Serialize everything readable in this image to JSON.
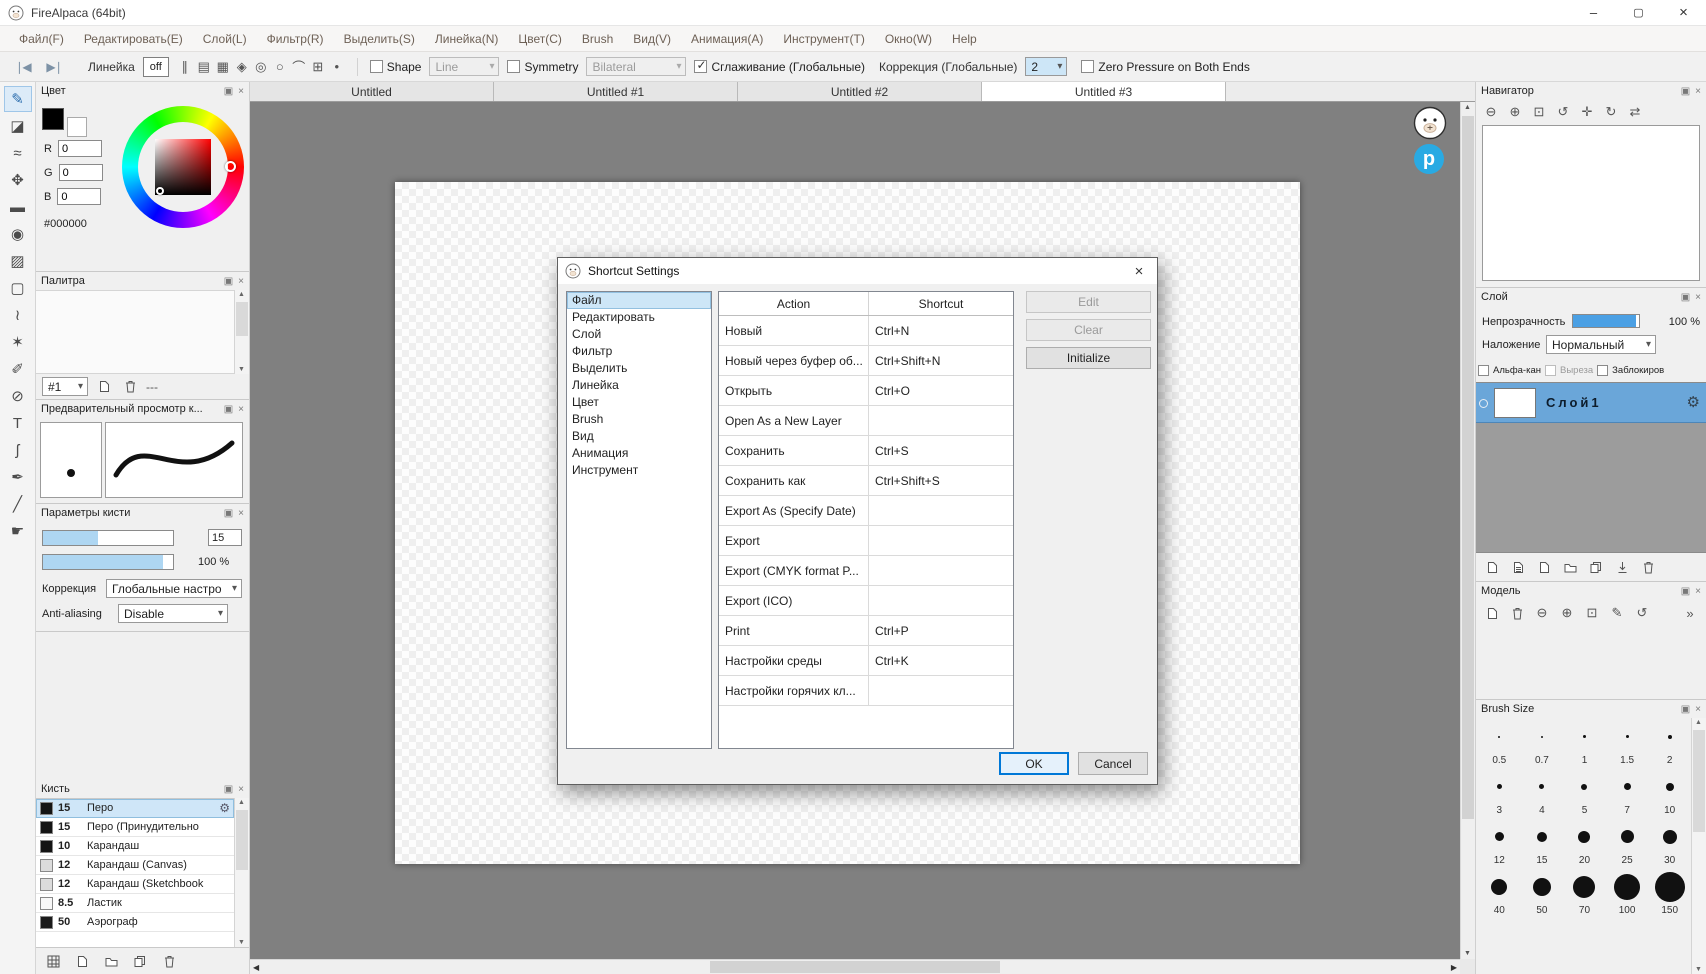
{
  "window": {
    "title": "FireAlpaca (64bit)"
  },
  "menubar": {
    "items": [
      "Файл(F)",
      "Редактировать(E)",
      "Слой(L)",
      "Фильтр(R)",
      "Выделить(S)",
      "Линейка(N)",
      "Цвет(C)",
      "Brush",
      "Вид(V)",
      "Анимация(A)",
      "Инструмент(T)",
      "Окно(W)",
      "Help"
    ]
  },
  "toolbar": {
    "ruler_label": "Линейка",
    "ruler_off": "off",
    "ruler_modes": [
      "parallel-ruler-icon",
      "grid-ruler-icon",
      "crosshatch-ruler-icon",
      "perspective-ruler-icon",
      "concentric-ruler-icon",
      "ellipse-ruler-icon",
      "curve-ruler-icon",
      "cell-ruler-icon",
      "dot-ruler-icon"
    ],
    "shape": {
      "label": "Shape",
      "value": "Line"
    },
    "symmetry": {
      "label": "Symmetry",
      "value": "Bilateral"
    },
    "smoothing_label": "Сглаживание (Глобальные)",
    "correction_label": "Коррекция (Глобальные)",
    "correction_value": "2",
    "zero_pressure_label": "Zero Pressure on Both Ends"
  },
  "toolbox": {
    "tools": [
      "brush-tool",
      "eraser-tool",
      "smudge-tool",
      "move-tool",
      "fill-tool",
      "bucket-tool",
      "gradient-tool",
      "select-rect-tool",
      "lasso-tool",
      "magic-wand-tool",
      "select-pen-tool",
      "select-eraser-tool",
      "text-tool",
      "curve-tool",
      "pen-tool",
      "eyedropper-tool",
      "hand-tool"
    ],
    "selected": "brush-tool"
  },
  "document_tabs": {
    "items": [
      "Untitled",
      "Untitled #1",
      "Untitled #2",
      "Untitled #3"
    ],
    "active_index": 3
  },
  "mascot": {
    "logo_letter": "p"
  },
  "panels": {
    "color": {
      "title": "Цвет",
      "r_label": "R",
      "g_label": "G",
      "b_label": "B",
      "r_value": "0",
      "g_value": "0",
      "b_value": "0",
      "hex_value": "#000000"
    },
    "palette": {
      "title": "Палитра",
      "slot_value": "#1",
      "placeholder": "---",
      "icons": [
        "palette-new-icon",
        "palette-delete-icon"
      ]
    },
    "preview": {
      "title": "Предварительный просмотр к..."
    },
    "brush_params": {
      "title": "Параметры кисти",
      "size_value": "15",
      "opacity_value": "100 %",
      "correction_label": "Коррекция",
      "correction_value": "Глобальные настро",
      "antialias_label": "Anti-aliasing",
      "antialias_value": "Disable"
    },
    "brushes": {
      "title": "Кисть",
      "items": [
        {
          "size": "15",
          "name": "Перо",
          "selected": true,
          "swatch": "#141414"
        },
        {
          "size": "15",
          "name": "Перо (Принудительно",
          "swatch": "#141414"
        },
        {
          "size": "10",
          "name": "Карандаш",
          "swatch": "#141414"
        },
        {
          "size": "12",
          "name": "Карандаш (Canvas)",
          "swatch": "#dcdcdc"
        },
        {
          "size": "12",
          "name": "Карандаш (Sketchbook",
          "swatch": "#dcdcdc"
        },
        {
          "size": "8.5",
          "name": "Ластик",
          "swatch": "#f8f8f8"
        },
        {
          "size": "50",
          "name": "Аэрограф",
          "swatch": "#1a1a1a"
        }
      ],
      "actions": [
        "brush-grid-icon",
        "new-brush-icon",
        "brush-folder-icon",
        "copy-brush-icon",
        "delete-brush-icon"
      ]
    },
    "navigator": {
      "title": "Навигатор",
      "icons": [
        "zoom-out-icon",
        "zoom-in-icon",
        "zoom-fit-icon",
        "rotate-left-icon",
        "reset-view-icon",
        "rotate-right-icon",
        "flip-horizontal-icon"
      ]
    },
    "layer": {
      "title": "Слой",
      "opacity_label": "Непрозрачность",
      "opacity_value": "100 %",
      "blend_label": "Наложение",
      "blend_value": "Нормальный",
      "checkboxes": [
        {
          "label": "Альфа-кан",
          "enabled": true
        },
        {
          "label": "Выреза",
          "enabled": false
        },
        {
          "label": "Заблокиров",
          "enabled": true
        }
      ],
      "layers": [
        {
          "name": "Слой1",
          "selected": true
        }
      ],
      "actions": [
        "add-layer-icon",
        "add-lined-layer-icon",
        "add-blank-layer-icon",
        "layer-folder-icon",
        "duplicate-layer-icon",
        "import-layer-icon",
        "delete-layer-icon"
      ]
    },
    "model": {
      "title": "Модель",
      "icons": [
        "new-model-icon",
        "delete-model-icon",
        "model-zoom-out-icon",
        "model-zoom-in-icon",
        "model-zoom-fit-icon",
        "model-edit-icon",
        "model-undo-icon",
        "model-more-icon"
      ]
    },
    "brush_size": {
      "title": "Brush Size",
      "sizes": [
        "0.5",
        "0.7",
        "1",
        "1.5",
        "2",
        "3",
        "4",
        "5",
        "7",
        "10",
        "12",
        "15",
        "20",
        "25",
        "30",
        "40",
        "50",
        "70",
        "100",
        "150"
      ]
    }
  },
  "dialog": {
    "title": "Shortcut Settings",
    "categories": [
      "Файл",
      "Редактировать",
      "Слой",
      "Фильтр",
      "Выделить",
      "Линейка",
      "Цвет",
      "Brush",
      "Вид",
      "Анимация",
      "Инструмент"
    ],
    "selected_category_index": 0,
    "table_headers": [
      "Action",
      "Shortcut"
    ],
    "rows": [
      [
        "Новый",
        "Ctrl+N"
      ],
      [
        "Новый через буфер об...",
        "Ctrl+Shift+N"
      ],
      [
        "Открыть",
        "Ctrl+O"
      ],
      [
        "Open As a New Layer",
        ""
      ],
      [
        "Сохранить",
        "Ctrl+S"
      ],
      [
        "Сохранить как",
        "Ctrl+Shift+S"
      ],
      [
        "Export As (Specify Date)",
        ""
      ],
      [
        "Export",
        ""
      ],
      [
        "Export (CMYK format P...",
        ""
      ],
      [
        "Export (ICO)",
        ""
      ],
      [
        "Print",
        "Ctrl+P"
      ],
      [
        "Настройки среды",
        "Ctrl+K"
      ],
      [
        "Настройки горячих кл...",
        ""
      ]
    ],
    "buttons": {
      "edit": "Edit",
      "clear": "Clear",
      "initialize": "Initialize",
      "ok": "OK",
      "cancel": "Cancel"
    }
  },
  "colors": {
    "accent": "#0078d7",
    "selection": "#cde6f7",
    "layer_selected": "#6aa6d9",
    "canvas_bg": "#808080"
  }
}
